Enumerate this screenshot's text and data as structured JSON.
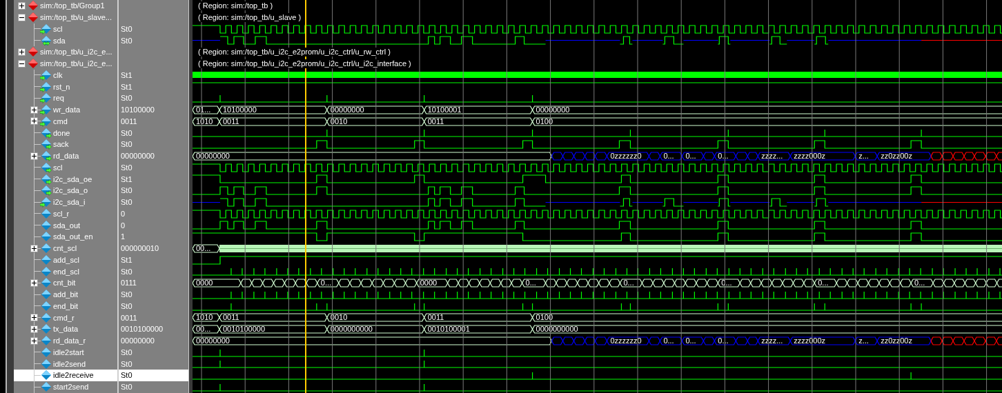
{
  "signals": [
    {
      "kind": "group",
      "name": "sim:/top_tb/Group1",
      "expanded": false,
      "selected": false,
      "region": "( Region: sim:/top_tb )"
    },
    {
      "kind": "group",
      "name": "sim:/top_tb/u_slave...",
      "expanded": true,
      "selected": false,
      "region": "( Region: sim:/top_tb/u_slave )",
      "children": [
        {
          "kind": "bit",
          "input": true,
          "output": false,
          "name": "scl",
          "value": "St0",
          "selected": false
        },
        {
          "kind": "bit",
          "input": true,
          "output": true,
          "name": "sda",
          "value": "St0",
          "selected": false
        }
      ]
    },
    {
      "kind": "group",
      "name": "sim:/top_tb/u_i2c_e...",
      "expanded": false,
      "selected": false,
      "region": "( Region: sim:/top_tb/u_i2c_e2prom/u_i2c_ctrl/u_rw_ctrl )"
    },
    {
      "kind": "group",
      "name": "sim:/top_tb/u_i2c_e...",
      "expanded": true,
      "selected": false,
      "region": "( Region: sim:/top_tb/u_i2c_e2prom/u_i2c_ctrl/u_i2c_interface )",
      "children": [
        {
          "kind": "bit",
          "input": true,
          "output": false,
          "name": "clk",
          "value": "St1",
          "selected": false
        },
        {
          "kind": "bit",
          "input": true,
          "output": false,
          "name": "rst_n",
          "value": "St1",
          "selected": false
        },
        {
          "kind": "bit",
          "input": true,
          "output": false,
          "name": "req",
          "value": "St0",
          "selected": false
        },
        {
          "kind": "bus",
          "input": true,
          "output": false,
          "name": "wr_data",
          "value": "10100000",
          "selected": false,
          "expanded": false,
          "wave_labels": [
            "01...",
            "10100000",
            "00000000",
            "10100001",
            "00000000"
          ]
        },
        {
          "kind": "bus",
          "input": true,
          "output": false,
          "name": "cmd",
          "value": "0011",
          "selected": false,
          "expanded": false,
          "wave_labels": [
            "1010",
            "0011",
            "0010",
            "0011",
            "0100"
          ]
        },
        {
          "kind": "bit",
          "input": false,
          "output": true,
          "name": "done",
          "value": "St0",
          "selected": false
        },
        {
          "kind": "bit",
          "input": false,
          "output": true,
          "name": "sack",
          "value": "St0",
          "selected": false
        },
        {
          "kind": "bus",
          "input": false,
          "output": true,
          "name": "rd_data",
          "value": "00000000",
          "selected": false,
          "expanded": false,
          "wave_labels": [
            "00000000",
            "0zzzzzz0",
            "0...",
            "0...",
            "0...",
            "zzzz...",
            "zzzz000z",
            "z...",
            "zz0zz00z"
          ]
        },
        {
          "kind": "bit",
          "input": false,
          "output": true,
          "name": "scl",
          "value": "St0",
          "selected": false
        },
        {
          "kind": "bit",
          "input": false,
          "output": true,
          "name": "i2c_sda_oe",
          "value": "St1",
          "selected": false
        },
        {
          "kind": "bit",
          "input": false,
          "output": true,
          "name": "i2c_sda_o",
          "value": "St0",
          "selected": false
        },
        {
          "kind": "bit",
          "input": true,
          "output": false,
          "name": "i2c_sda_i",
          "value": "St0",
          "selected": false
        },
        {
          "kind": "bit",
          "input": false,
          "output": false,
          "name": "scl_r",
          "value": "0",
          "selected": false
        },
        {
          "kind": "bit",
          "input": false,
          "output": false,
          "name": "sda_out",
          "value": "0",
          "selected": false
        },
        {
          "kind": "bit",
          "input": false,
          "output": false,
          "name": "sda_out_en",
          "value": "1",
          "selected": false
        },
        {
          "kind": "bus",
          "input": false,
          "output": false,
          "name": "cnt_scl",
          "value": "000000010",
          "selected": false,
          "expanded": false,
          "wave_labels": [
            "00..."
          ]
        },
        {
          "kind": "bit",
          "input": false,
          "output": false,
          "name": "add_scl",
          "value": "St1",
          "selected": false
        },
        {
          "kind": "bit",
          "input": false,
          "output": false,
          "name": "end_scl",
          "value": "St0",
          "selected": false
        },
        {
          "kind": "bus",
          "input": false,
          "output": false,
          "name": "cnt_bit",
          "value": "0111",
          "selected": false,
          "expanded": false,
          "wave_labels": [
            "0000",
            "0...",
            "0000",
            "0...",
            "0...",
            "0...",
            "0...",
            "0..."
          ]
        },
        {
          "kind": "bit",
          "input": false,
          "output": false,
          "name": "add_bit",
          "value": "St0",
          "selected": false
        },
        {
          "kind": "bit",
          "input": false,
          "output": false,
          "name": "end_bit",
          "value": "St0",
          "selected": false
        },
        {
          "kind": "bus",
          "input": false,
          "output": false,
          "name": "cmd_r",
          "value": "0011",
          "selected": false,
          "expanded": false,
          "wave_labels": [
            "1010",
            "0011",
            "0010",
            "0011",
            "0100"
          ]
        },
        {
          "kind": "bus",
          "input": false,
          "output": false,
          "name": "tx_data",
          "value": "0010100000",
          "selected": false,
          "expanded": false,
          "wave_labels": [
            "00...",
            "0010100000",
            "0000000000",
            "0010100001",
            "0000000000"
          ]
        },
        {
          "kind": "bus",
          "input": false,
          "output": false,
          "name": "rd_data_r",
          "value": "00000000",
          "selected": false,
          "expanded": false,
          "wave_labels": [
            "00000000",
            "0zzzzzz0",
            "0...",
            "0...",
            "0...",
            "zzzz...",
            "zzzz000z",
            "z...",
            "zz0zz00z"
          ]
        },
        {
          "kind": "bit",
          "input": false,
          "output": false,
          "name": "idle2start",
          "value": "St0",
          "selected": false
        },
        {
          "kind": "bit",
          "input": false,
          "output": false,
          "name": "idle2send",
          "value": "St0",
          "selected": false
        },
        {
          "kind": "bit",
          "input": false,
          "output": false,
          "name": "idle2receive",
          "value": "St0",
          "selected": true
        },
        {
          "kind": "bit",
          "input": false,
          "output": false,
          "name": "start2send",
          "value": "St0",
          "selected": false
        }
      ]
    }
  ]
}
